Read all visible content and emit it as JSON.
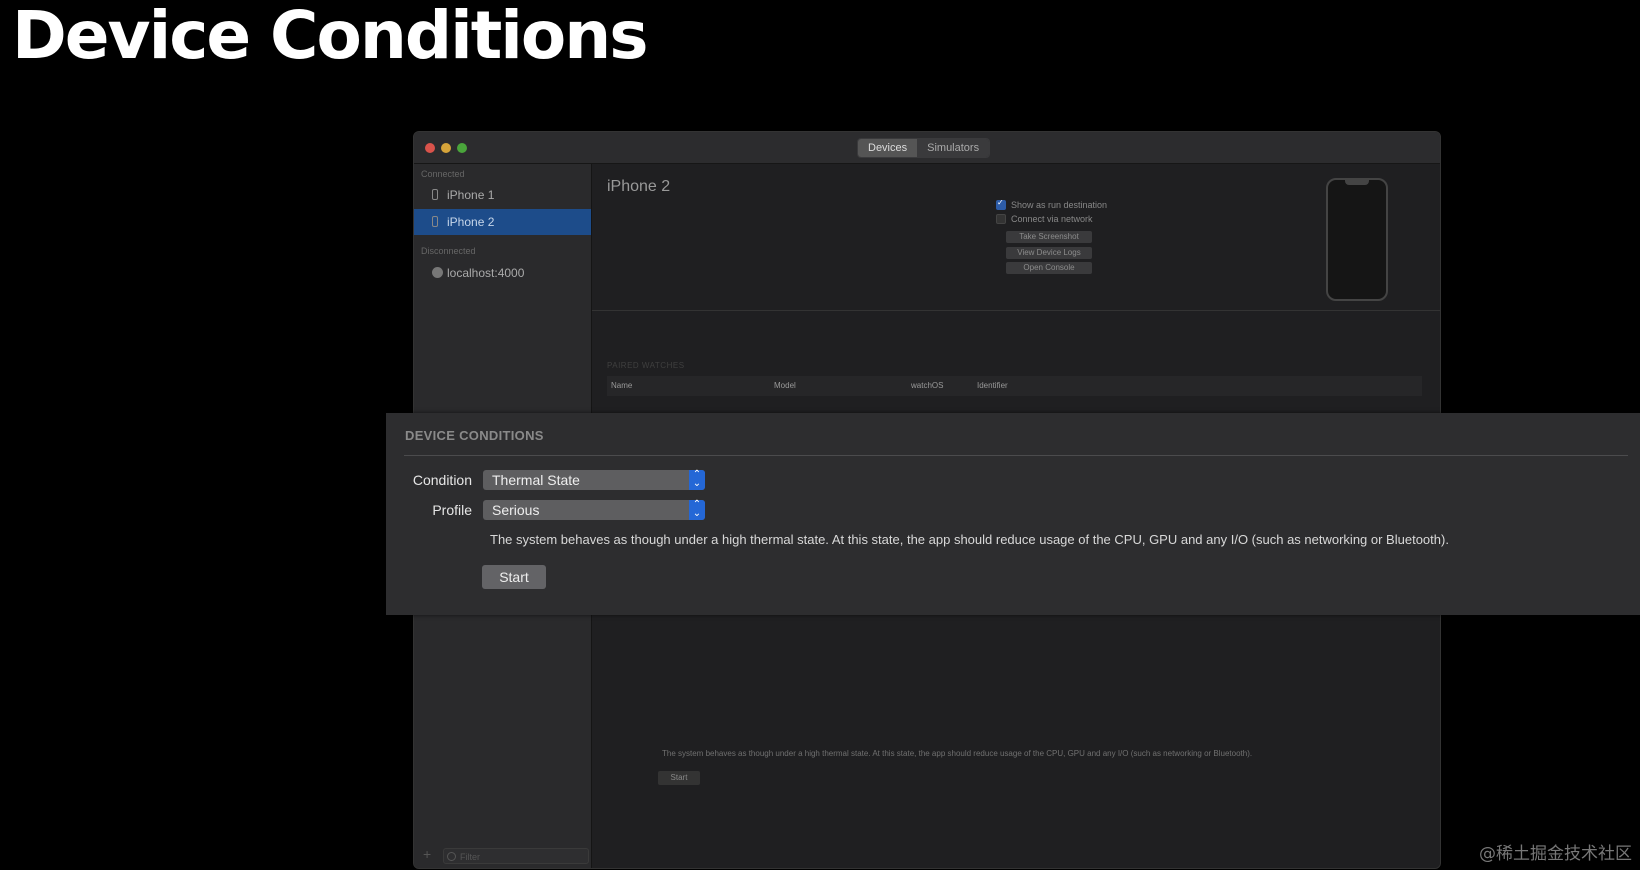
{
  "slide": {
    "title": "Device Conditions"
  },
  "window": {
    "tabs": [
      {
        "label": "Devices",
        "active": true
      },
      {
        "label": "Simulators",
        "active": false
      }
    ]
  },
  "sidebar": {
    "sections": {
      "connected": "Connected",
      "disconnected": "Disconnected"
    },
    "items": [
      {
        "label": "iPhone 1",
        "icon": "iphone-icon",
        "selected": false
      },
      {
        "label": "iPhone 2",
        "icon": "iphone-icon",
        "selected": true
      },
      {
        "label": "localhost:4000",
        "icon": "globe-icon",
        "selected": false
      }
    ],
    "filter_placeholder": "Filter"
  },
  "device": {
    "name": "iPhone 2",
    "show_as_run_destination": {
      "label": "Show as run destination",
      "checked": true
    },
    "connect_via_network": {
      "label": "Connect via network",
      "checked": false
    },
    "buttons": [
      "Take Screenshot",
      "View Device Logs",
      "Open Console"
    ]
  },
  "paired_watches": {
    "title": "PAIRED WATCHES",
    "columns": [
      "Name",
      "Model",
      "watchOS",
      "Identifier"
    ]
  },
  "background_conditions": {
    "description": "The system behaves as though under a high thermal state. At this state, the app should reduce usage of the CPU, GPU and any I/O (such as networking or Bluetooth).",
    "start_label": "Start"
  },
  "device_conditions": {
    "title": "DEVICE CONDITIONS",
    "condition_label": "Condition",
    "condition_value": "Thermal State",
    "profile_label": "Profile",
    "profile_value": "Serious",
    "description": "The system behaves as though under a high thermal state. At this state, the app should reduce usage of the CPU, GPU and any I/O (such as networking or Bluetooth).",
    "start_label": "Start"
  },
  "watermark": "@稀土掘金技术社区",
  "colors": {
    "background": "#000000",
    "selection": "#1d4c8a",
    "popup_accent": "#2467d6"
  }
}
